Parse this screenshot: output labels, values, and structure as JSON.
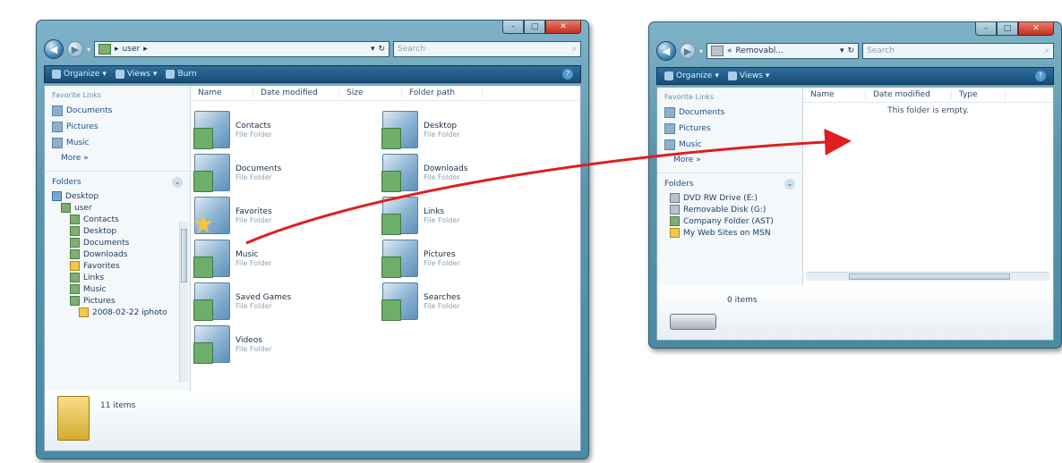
{
  "left_window": {
    "address": "user",
    "search_placeholder": "Search",
    "toolbar": {
      "organize": "Organize",
      "views": "Views",
      "burn": "Burn"
    },
    "nav_heading": "Favorite Links",
    "favorite_links": [
      "Documents",
      "Pictures",
      "Music"
    ],
    "more": "More »",
    "folders_label": "Folders",
    "tree": [
      {
        "label": "Desktop",
        "level": 0,
        "icon": "blue"
      },
      {
        "label": "user",
        "level": 1,
        "icon": "green"
      },
      {
        "label": "Contacts",
        "level": 2,
        "icon": "green"
      },
      {
        "label": "Desktop",
        "level": 2,
        "icon": "green"
      },
      {
        "label": "Documents",
        "level": 2,
        "icon": "green"
      },
      {
        "label": "Downloads",
        "level": 2,
        "icon": "green"
      },
      {
        "label": "Favorites",
        "level": 2,
        "icon": "yellow"
      },
      {
        "label": "Links",
        "level": 2,
        "icon": "green"
      },
      {
        "label": "Music",
        "level": 2,
        "icon": "green"
      },
      {
        "label": "Pictures",
        "level": 2,
        "icon": "green"
      },
      {
        "label": "2008-02-22 iphoto",
        "level": 3,
        "icon": "yellow"
      }
    ],
    "columns": [
      "Name",
      "Date modified",
      "Size",
      "Folder path"
    ],
    "items": [
      {
        "name": "Contacts",
        "type": "File Folder",
        "icon": "folder"
      },
      {
        "name": "Desktop",
        "type": "File Folder",
        "icon": "folder"
      },
      {
        "name": "Documents",
        "type": "File Folder",
        "icon": "folder"
      },
      {
        "name": "Downloads",
        "type": "File Folder",
        "icon": "folder"
      },
      {
        "name": "Favorites",
        "type": "File Folder",
        "icon": "star"
      },
      {
        "name": "Links",
        "type": "File Folder",
        "icon": "folder"
      },
      {
        "name": "Music",
        "type": "File Folder",
        "icon": "folder"
      },
      {
        "name": "Pictures",
        "type": "File Folder",
        "icon": "folder"
      },
      {
        "name": "Saved Games",
        "type": "File Folder",
        "icon": "folder"
      },
      {
        "name": "Searches",
        "type": "File Folder",
        "icon": "folder"
      },
      {
        "name": "Videos",
        "type": "File Folder",
        "icon": "folder"
      }
    ],
    "status": "11 items"
  },
  "right_window": {
    "address": "Removabl...",
    "search_placeholder": "Search",
    "toolbar": {
      "organize": "Organize",
      "views": "Views"
    },
    "nav_heading": "Favorite Links",
    "favorite_links": [
      "Documents",
      "Pictures",
      "Music"
    ],
    "more": "More »",
    "folders_label": "Folders",
    "tree": [
      {
        "label": "DVD RW Drive (E:)",
        "level": 1,
        "icon": "drive"
      },
      {
        "label": "Removable Disk (G:)",
        "level": 1,
        "icon": "drive"
      },
      {
        "label": "Company Folder (AST)",
        "level": 1,
        "icon": "green"
      },
      {
        "label": "My Web Sites on MSN",
        "level": 1,
        "icon": "yellow"
      }
    ],
    "columns": [
      "Name",
      "Date modified",
      "Type"
    ],
    "empty_message": "This folder is empty.",
    "status": "0 items"
  },
  "colors": {
    "arrow": "#e01e1e",
    "chrome": "#5a95ad",
    "toolbar": "#1f5a86"
  }
}
